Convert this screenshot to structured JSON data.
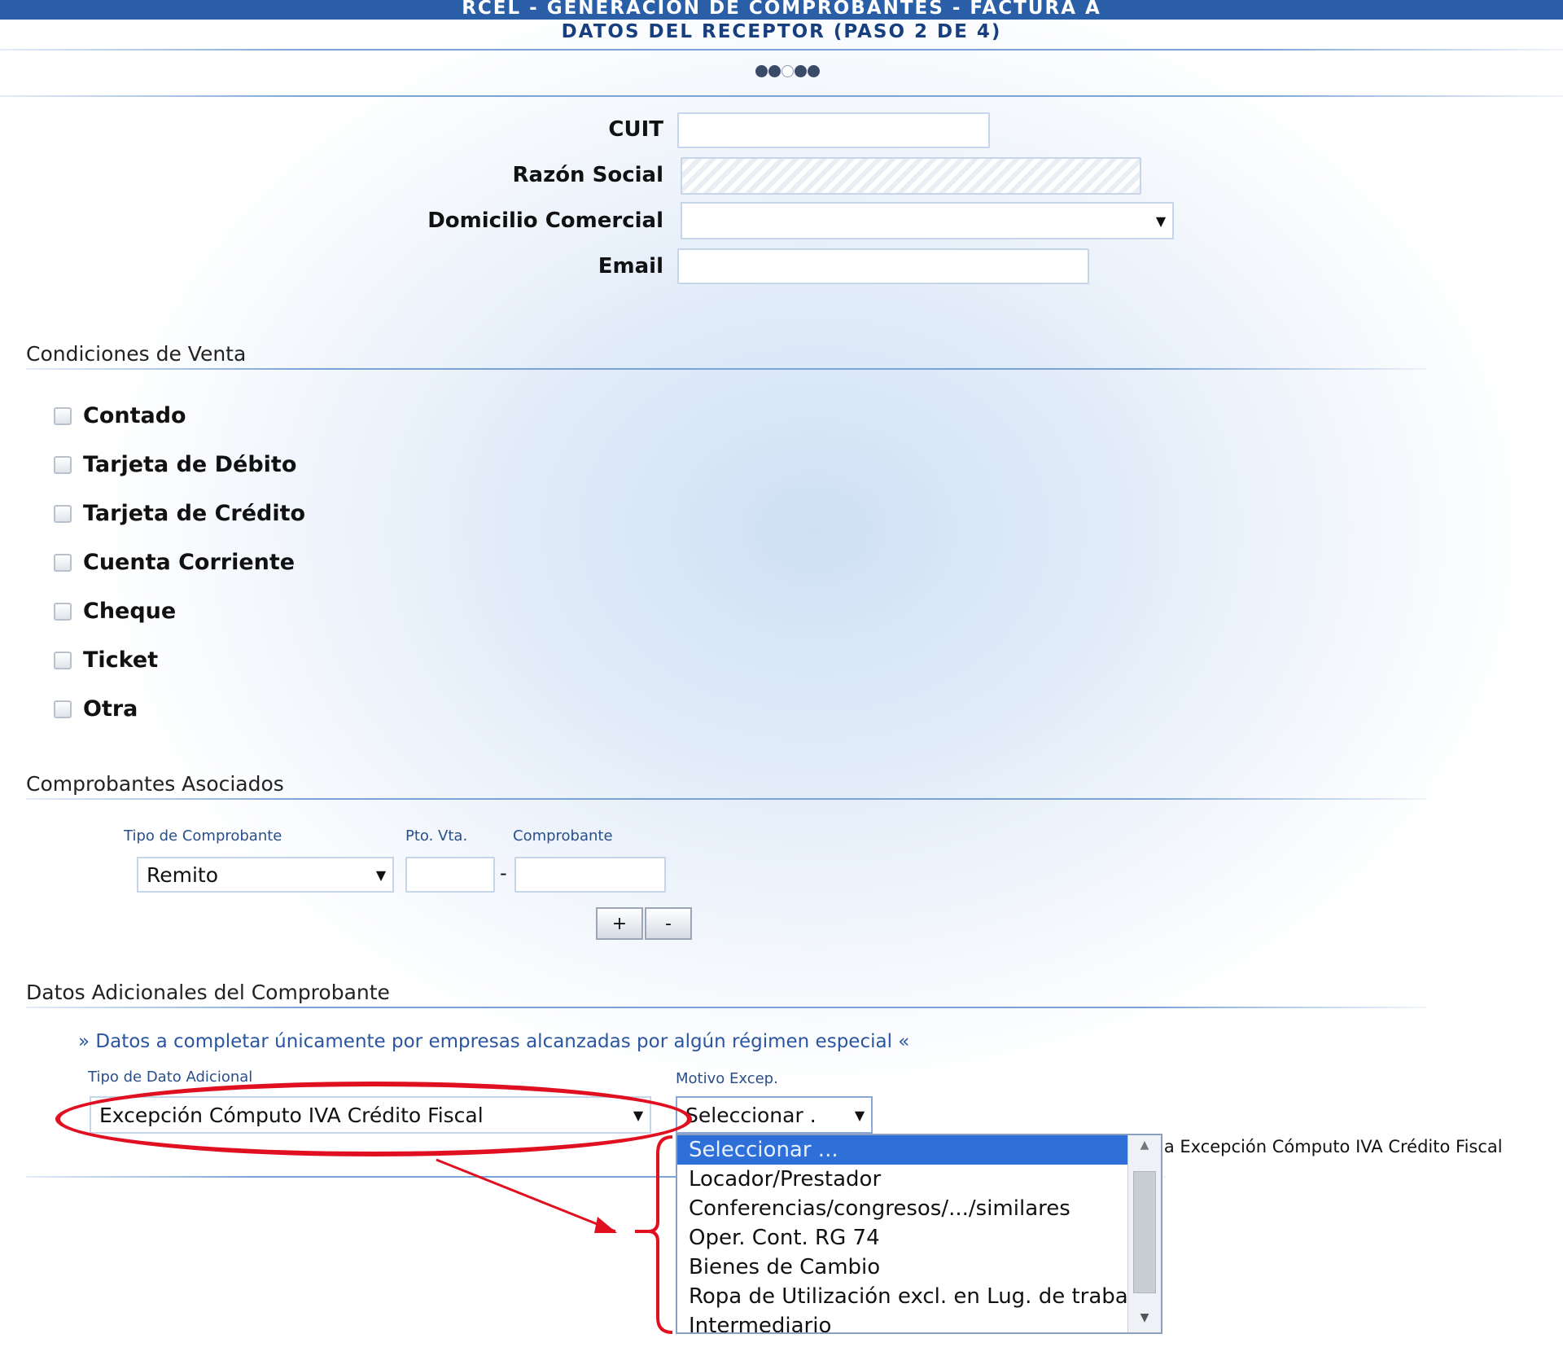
{
  "header": {
    "title": "RCEL - GENERACION DE COMPROBANTES - FACTURA A",
    "subtitle": "DATOS DEL RECEPTOR (PASO 2 DE 4)",
    "steps_total": 5,
    "step_current": 3
  },
  "receptor": {
    "cuit_label": "CUIT",
    "cuit_value": "",
    "razon_label": "Razón Social",
    "razon_value": "",
    "domicilio_label": "Domicilio Comercial",
    "domicilio_value": "",
    "email_label": "Email",
    "email_value": ""
  },
  "condiciones": {
    "title": "Condiciones de Venta",
    "options": [
      {
        "label": "Contado",
        "checked": false
      },
      {
        "label": "Tarjeta de Débito",
        "checked": false
      },
      {
        "label": "Tarjeta de Crédito",
        "checked": false
      },
      {
        "label": "Cuenta Corriente",
        "checked": false
      },
      {
        "label": "Cheque",
        "checked": false
      },
      {
        "label": "Ticket",
        "checked": false
      },
      {
        "label": "Otra",
        "checked": false
      }
    ]
  },
  "asociados": {
    "title": "Comprobantes Asociados",
    "tipo_label": "Tipo de Comprobante",
    "tipo_value": "Remito",
    "ptovta_label": "Pto. Vta.",
    "ptovta_value": "",
    "separator": "-",
    "comprobante_label": "Comprobante",
    "comprobante_value": "",
    "add_label": "+",
    "remove_label": "-"
  },
  "adicionales": {
    "title": "Datos Adicionales del Comprobante",
    "note": "» Datos a completar únicamente por empresas alcanzadas por algún régimen especial «",
    "tipo_label": "Tipo de Dato Adicional",
    "tipo_value": "Excepción Cómputo IVA Crédito Fiscal",
    "motivo_label": "Motivo Excep.",
    "motivo_value": "Seleccionar .",
    "trailing_text": "la Excepción Cómputo IVA Crédito Fiscal",
    "dropdown_options": [
      "Seleccionar ...",
      "Locador/Prestador",
      "Conferencias/congresos/.../similares",
      "Oper. Cont. RG 74",
      "Bienes de Cambio",
      "Ropa de Utilización excl. en Lug. de trabajo",
      "Intermediario"
    ],
    "dropdown_selected_index": 0
  },
  "colors": {
    "header_bar": "#2a5fa8",
    "accent_blue": "#2a55a0",
    "annotation_red": "#e01020",
    "selected_option": "#2e6fd8"
  }
}
